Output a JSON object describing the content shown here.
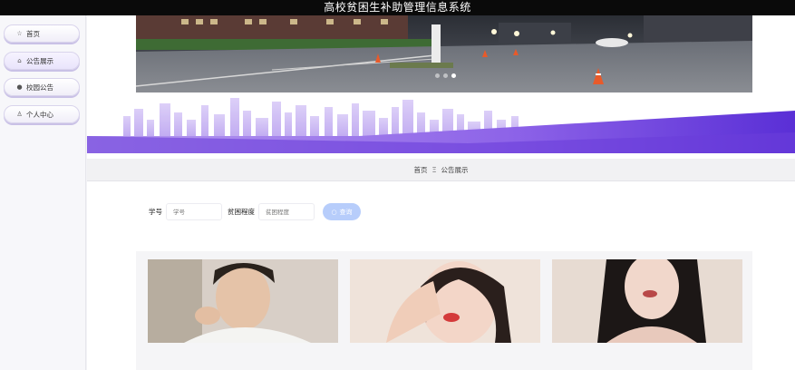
{
  "app": {
    "title": "高校贫困生补助管理信息系统"
  },
  "sidebar": {
    "items": [
      {
        "label": "首页",
        "icon": "star-icon"
      },
      {
        "label": "公告展示",
        "icon": "bag-icon"
      },
      {
        "label": "校园公告",
        "icon": "info-icon"
      },
      {
        "label": "个人中心",
        "icon": "user-icon"
      }
    ],
    "active_index": 1
  },
  "carousel": {
    "slide_count": 3,
    "active_slide": 3
  },
  "breadcrumb": {
    "home": "首页",
    "separator": "Ξ",
    "current": "公告展示"
  },
  "search": {
    "field1_label": "学号",
    "field1_placeholder": "学号",
    "field2_label": "贫困程度",
    "field2_placeholder": "贫困程度",
    "button_label": "查询"
  },
  "colors": {
    "accent": "#6a3ddb",
    "banner_gradient_end": "#5a2fd6",
    "search_button": "#b7cdfb",
    "title_bar": "#0a0a0a"
  }
}
